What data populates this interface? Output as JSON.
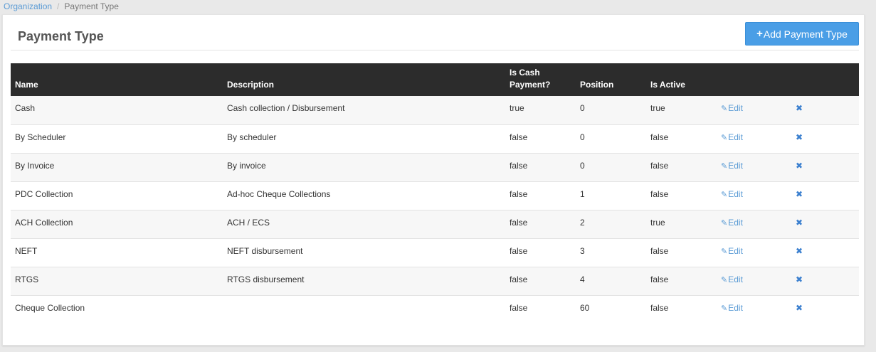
{
  "breadcrumb": {
    "parent": "Organization",
    "current": "Payment Type"
  },
  "header": {
    "title": "Payment Type",
    "add_button_icon": "+",
    "add_button_label": "Add Payment Type"
  },
  "table": {
    "columns": {
      "name": "Name",
      "description": "Description",
      "is_cash_line1": "Is Cash",
      "is_cash_line2": "Payment?",
      "position": "Position",
      "is_active": "Is Active"
    },
    "edit_label": "Edit",
    "edit_icon": "✎",
    "delete_icon": "✖",
    "rows": [
      {
        "name": "Cash",
        "description": "Cash collection / Disbursement",
        "is_cash": "true",
        "position": "0",
        "is_active": "true"
      },
      {
        "name": "By Scheduler",
        "description": "By scheduler",
        "is_cash": "false",
        "position": "0",
        "is_active": "false"
      },
      {
        "name": "By Invoice",
        "description": "By invoice",
        "is_cash": "false",
        "position": "0",
        "is_active": "false"
      },
      {
        "name": "PDC Collection",
        "description": "Ad-hoc Cheque Collections",
        "is_cash": "false",
        "position": "1",
        "is_active": "false"
      },
      {
        "name": "ACH Collection",
        "description": "ACH / ECS",
        "is_cash": "false",
        "position": "2",
        "is_active": "true"
      },
      {
        "name": "NEFT",
        "description": "NEFT disbursement",
        "is_cash": "false",
        "position": "3",
        "is_active": "false"
      },
      {
        "name": "RTGS",
        "description": "RTGS disbursement",
        "is_cash": "false",
        "position": "4",
        "is_active": "false"
      },
      {
        "name": "Cheque Collection",
        "description": "",
        "is_cash": "false",
        "position": "60",
        "is_active": "false"
      }
    ]
  },
  "colors": {
    "accent": "#4a9ee6",
    "link": "#5a9bd5",
    "table_header_bg": "#2c2c2c"
  }
}
